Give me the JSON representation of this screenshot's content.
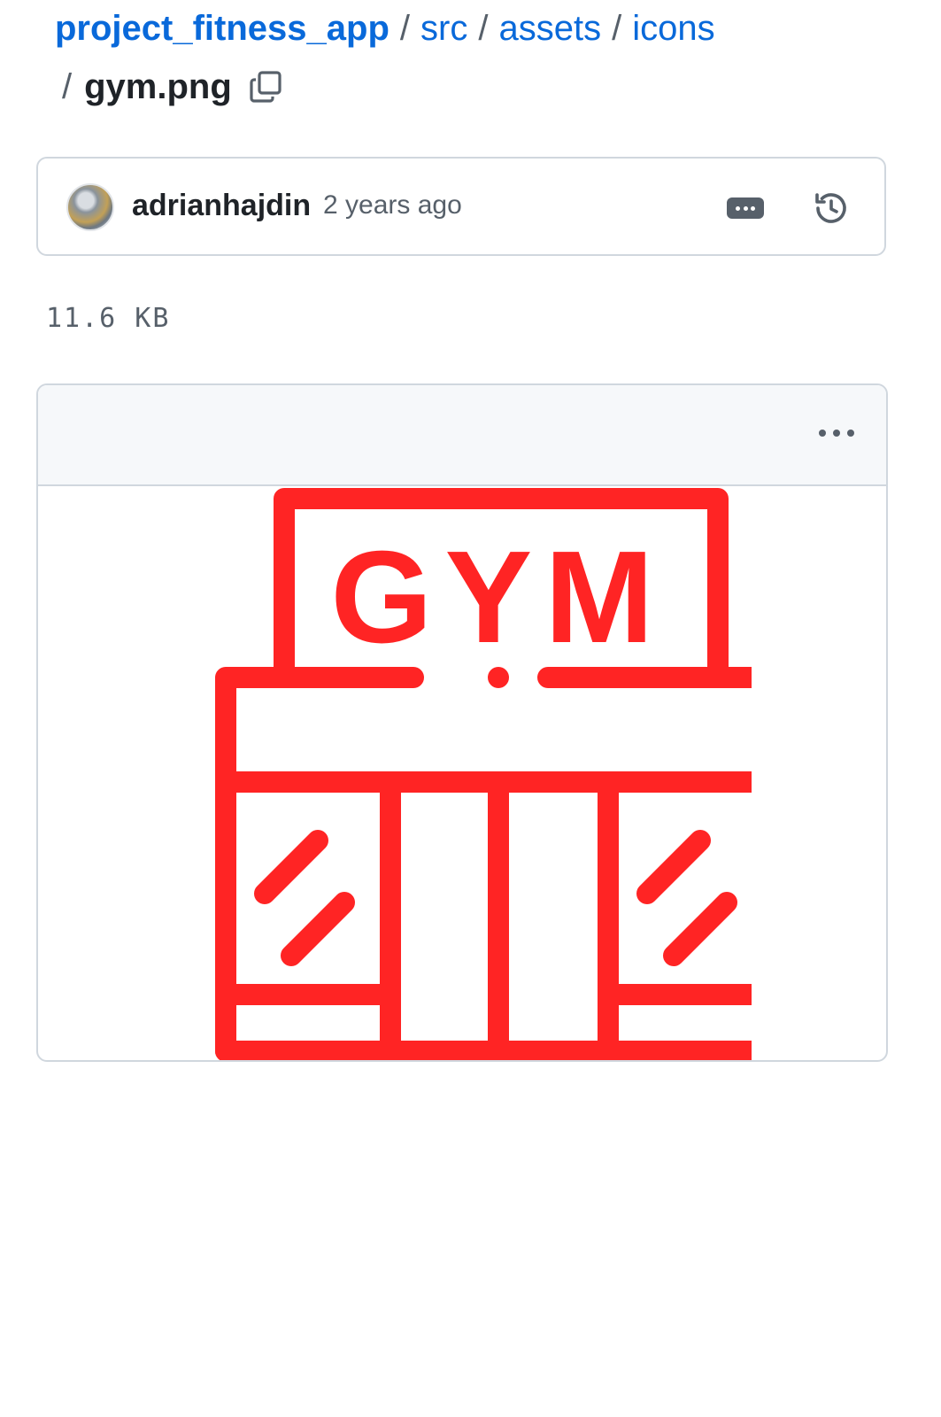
{
  "breadcrumb": {
    "repo": "project_fitness_app",
    "folders": [
      "src",
      "assets",
      "icons"
    ],
    "separator": "/",
    "file": "gym.png"
  },
  "commit": {
    "author": "adrianhajdin",
    "age": "2 years ago"
  },
  "file_info": {
    "size": "11.6 KB"
  },
  "image": {
    "sign_text": "GYM",
    "color": "#ff2424"
  },
  "icons": {
    "copy": "copy-icon",
    "commit_ellipsis": "ellipsis-icon",
    "history": "history-icon",
    "kebab": "kebab-horizontal-icon"
  }
}
